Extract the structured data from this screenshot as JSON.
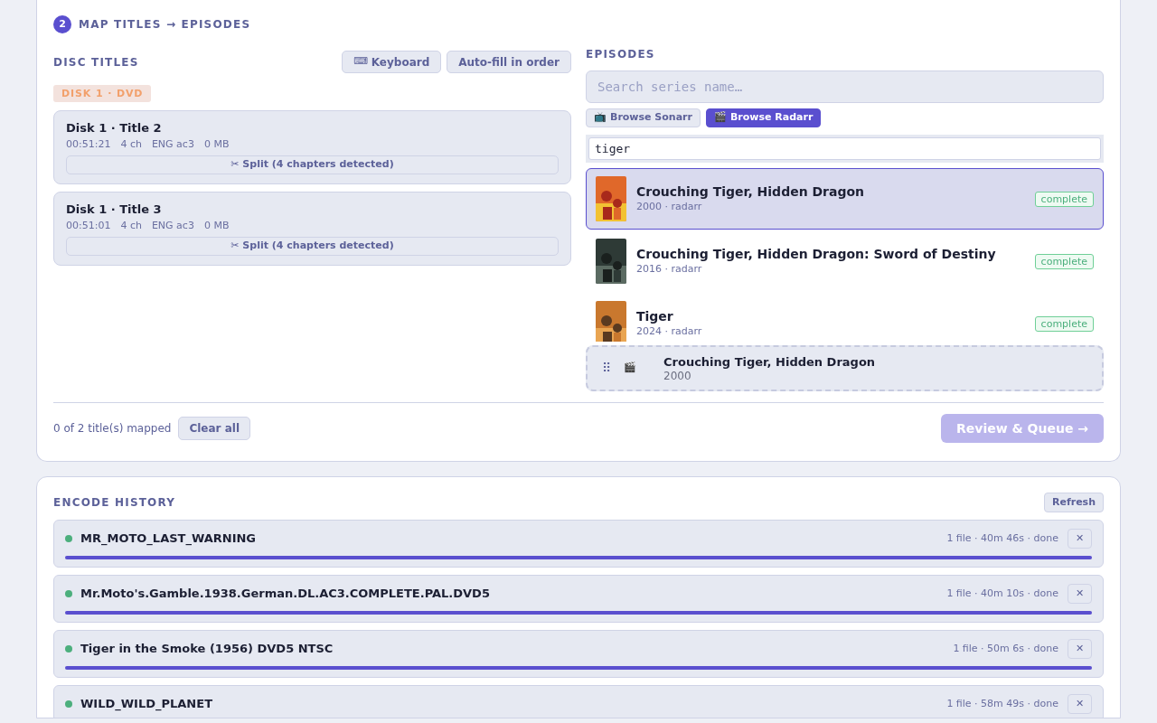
{
  "map_section": {
    "step": "2",
    "title": "MAP TITLES → EPISODES",
    "disc_titles": {
      "heading": "DISC TITLES",
      "buttons": [
        {
          "icon": "⌨",
          "label": "Keyboard"
        },
        {
          "label": "Auto-fill in order"
        }
      ],
      "disk_label": "DISK 1 · DVD",
      "titles": [
        {
          "name": "Disk 1 · Title 2",
          "duration": "00:51:21",
          "chapters": "4 ch",
          "audio": "ENG ac3",
          "size": "0 MB",
          "split": "✂ Split (4 chapters detected)"
        },
        {
          "name": "Disk 1 · Title 3",
          "duration": "00:51:01",
          "chapters": "4 ch",
          "audio": "ENG ac3",
          "size": "0 MB",
          "split": "✂ Split (4 chapters detected)"
        }
      ]
    },
    "episodes": {
      "heading": "EPISODES",
      "search_placeholder": "Search series name…",
      "sources": [
        {
          "icon": "📺",
          "label": "Browse Sonarr",
          "selected": false
        },
        {
          "icon": "🎬",
          "label": "Browse Radarr",
          "selected": true
        }
      ],
      "filter_value": "tiger",
      "results": [
        {
          "title": "Crouching Tiger, Hidden Dragon",
          "meta": "2000 · radarr",
          "badge": "complete",
          "selected": true
        },
        {
          "title": "Crouching Tiger, Hidden Dragon: Sword of Destiny",
          "meta": "2016 · radarr",
          "badge": "complete",
          "selected": false
        },
        {
          "title": "Tiger",
          "meta": "2024 · radarr",
          "badge": "complete",
          "selected": false
        }
      ],
      "drag_item": {
        "handle": "⠿",
        "icon": "🎬",
        "title": "Crouching Tiger, Hidden Dragon",
        "year": "2000"
      }
    },
    "footer": {
      "status": "0 of 2 title(s) mapped",
      "clear": "Clear all",
      "submit": "Review & Queue →",
      "submit_disabled": true
    }
  },
  "encode_history": {
    "heading": "ENCODE HISTORY",
    "refresh": "Refresh",
    "jobs": [
      {
        "name": "MR_MOTO_LAST_WARNING",
        "meta": "1 file · 40m 46s · done",
        "color": "#4caf7d",
        "level": 1,
        "close": "✕"
      },
      {
        "name": "Mr.Moto's.Gamble.1938.German.DL.AC3.COMPLETE.PAL.DVD5",
        "meta": "1 file · 40m 10s · done",
        "color": "#4caf7d",
        "level": 1,
        "close": "✕"
      },
      {
        "name": "Tiger in the Smoke (1956) DVD5 NTSC",
        "meta": "1 file · 50m 6s · done",
        "color": "#4caf7d",
        "level": 1,
        "close": "✕"
      },
      {
        "name": "WILD_WILD_PLANET",
        "meta": "1 file · 58m 49s · done",
        "color": "#4caf7d",
        "close": "✕"
      }
    ]
  }
}
